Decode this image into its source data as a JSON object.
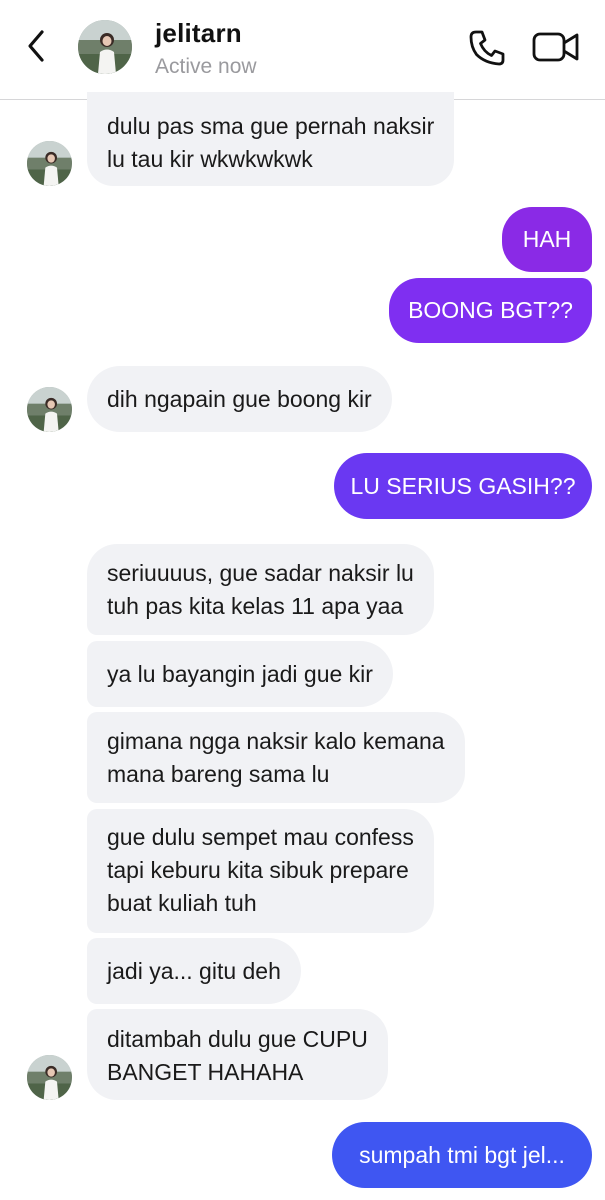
{
  "header": {
    "name": "jelitarn",
    "status": "Active now"
  },
  "messages": [
    {
      "sender": "them",
      "lines": [
        "dulu pas sma gue pernah naksir",
        "lu tau kir wkwkwkwk"
      ]
    },
    {
      "sender": "me",
      "lines": [
        "HAH"
      ]
    },
    {
      "sender": "me",
      "lines": [
        "BOONG BGT??"
      ]
    },
    {
      "sender": "them",
      "lines": [
        "dih ngapain gue boong kir"
      ]
    },
    {
      "sender": "me",
      "lines": [
        "LU SERIUS GASIH??"
      ]
    },
    {
      "sender": "them",
      "lines": [
        "seriuuuus, gue sadar naksir lu",
        "tuh pas kita kelas 11 apa yaa"
      ]
    },
    {
      "sender": "them",
      "lines": [
        "ya lu bayangin jadi gue kir"
      ]
    },
    {
      "sender": "them",
      "lines": [
        "gimana ngga naksir kalo kemana",
        "mana bareng sama lu"
      ]
    },
    {
      "sender": "them",
      "lines": [
        "gue dulu sempet mau confess",
        "tapi keburu kita sibuk prepare",
        "buat kuliah tuh"
      ]
    },
    {
      "sender": "them",
      "lines": [
        "jadi ya... gitu deh"
      ]
    },
    {
      "sender": "them",
      "lines": [
        "ditambah dulu gue CUPU",
        "BANGET HAHAHA"
      ]
    },
    {
      "sender": "me",
      "lines": [
        "sumpah tmi bgt jel..."
      ]
    }
  ],
  "colors": {
    "incoming_bubble": "#f1f2f5",
    "outgoing_gradient_top": "#8a2be6",
    "outgoing_gradient_bottom": "#3f56f2"
  },
  "icons": {
    "back": "chevron-left-icon",
    "call": "phone-icon",
    "video": "video-camera-icon"
  }
}
